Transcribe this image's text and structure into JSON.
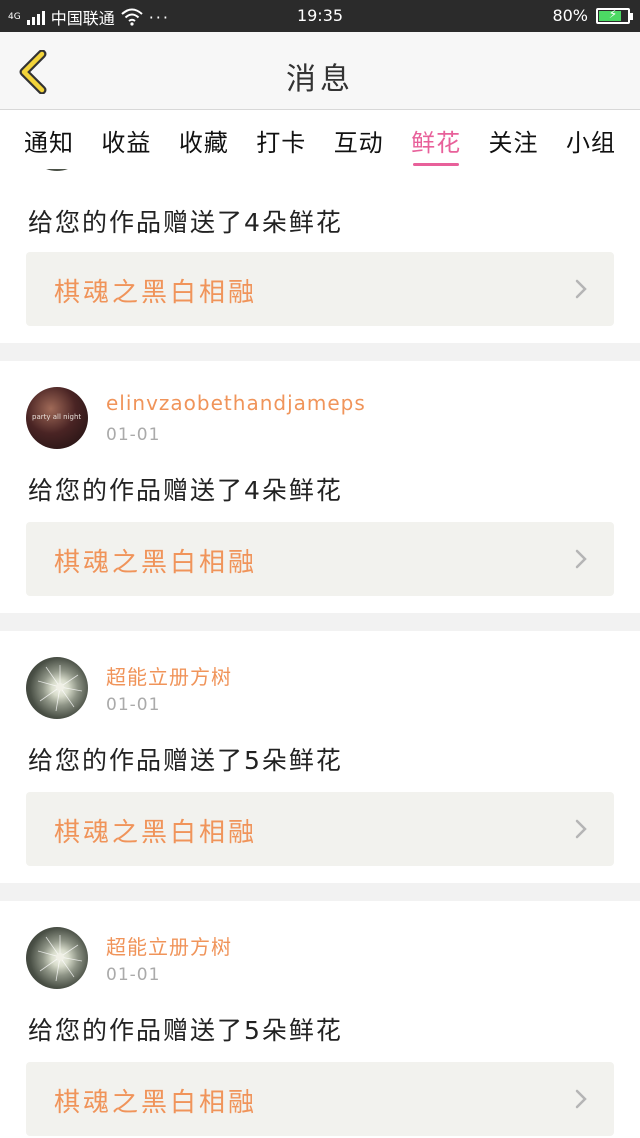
{
  "status_bar": {
    "network": "4G",
    "carrier": "中国联通",
    "dots": "···",
    "time": "19:35",
    "battery_percent": "80%",
    "battery_level": 0.8
  },
  "header": {
    "title": "消息",
    "back_icon": "chevron-left-icon"
  },
  "tabs": [
    {
      "label": "通知",
      "active": false
    },
    {
      "label": "收益",
      "active": false
    },
    {
      "label": "收藏",
      "active": false
    },
    {
      "label": "打卡",
      "active": false
    },
    {
      "label": "互动",
      "active": false
    },
    {
      "label": "鲜花",
      "active": true
    },
    {
      "label": "关注",
      "active": false
    },
    {
      "label": "小组",
      "active": false
    }
  ],
  "colors": {
    "accent_pink": "#e8609a",
    "accent_orange": "#f0945a"
  },
  "messages": [
    {
      "user": "",
      "date": "",
      "text": "给您的作品赠送了4朵鲜花",
      "work_title": "棋魂之黑白相融"
    },
    {
      "user": "elinvzaobethandjameps",
      "avatar_caption": "party all night",
      "date": "01-01",
      "text": "给您的作品赠送了4朵鲜花",
      "work_title": "棋魂之黑白相融"
    },
    {
      "user": "超能立册方树",
      "date": "01-01",
      "text": "给您的作品赠送了5朵鲜花",
      "work_title": "棋魂之黑白相融"
    },
    {
      "user": "超能立册方树",
      "date": "01-01",
      "text": "给您的作品赠送了5朵鲜花",
      "work_title": "棋魂之黑白相融"
    }
  ]
}
